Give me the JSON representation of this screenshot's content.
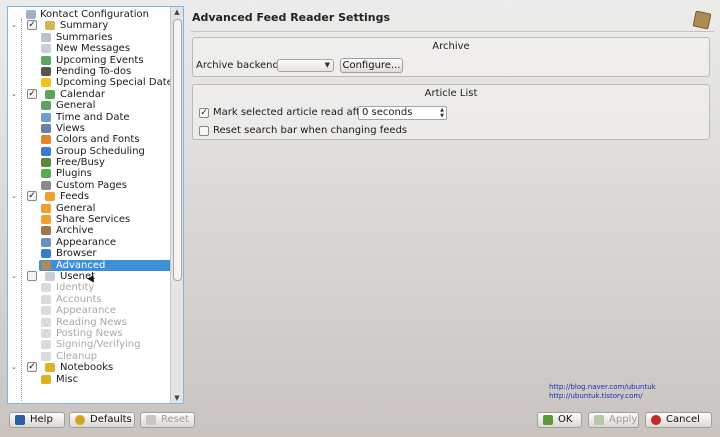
{
  "header": {
    "title": "Advanced Feed Reader Settings",
    "icon": "package-icon"
  },
  "tree": {
    "items": [
      {
        "label": "Kontact Configuration",
        "level": 0,
        "icon": "kontact-icon",
        "color": "#9fb0c8"
      },
      {
        "label": "Summary",
        "level": 1,
        "checked": true,
        "expanded": true,
        "icon": "summary-icon",
        "color": "#d9b35a"
      },
      {
        "label": "Summaries",
        "level": 2,
        "icon": "summaries-icon",
        "color": "#b7c2d3"
      },
      {
        "label": "New Messages",
        "level": 2,
        "icon": "mail-icon",
        "color": "#c9ced6"
      },
      {
        "label": "Upcoming Events",
        "level": 2,
        "icon": "calendar-icon",
        "color": "#5aa65a"
      },
      {
        "label": "Pending To-dos",
        "level": 2,
        "icon": "todo-icon",
        "color": "#555555"
      },
      {
        "label": "Upcoming Special Dates",
        "level": 2,
        "icon": "star-icon",
        "color": "#f0c419"
      },
      {
        "label": "Calendar",
        "level": 1,
        "checked": true,
        "expanded": true,
        "icon": "calendar-icon",
        "color": "#5aa65a"
      },
      {
        "label": "General",
        "level": 2,
        "icon": "calendar-general-icon",
        "color": "#5aa65a"
      },
      {
        "label": "Time and Date",
        "level": 2,
        "icon": "clock-icon",
        "color": "#6b9ec9"
      },
      {
        "label": "Views",
        "level": 2,
        "icon": "views-icon",
        "color": "#6d7fa3"
      },
      {
        "label": "Colors and Fonts",
        "level": 2,
        "icon": "colors-icon",
        "color": "#e1862b"
      },
      {
        "label": "Group Scheduling",
        "level": 2,
        "icon": "globe-icon",
        "color": "#3a7ec9"
      },
      {
        "label": "Free/Busy",
        "level": 2,
        "icon": "freebusy-icon",
        "color": "#5c8a3b"
      },
      {
        "label": "Plugins",
        "level": 2,
        "icon": "plugin-icon",
        "color": "#52b04a"
      },
      {
        "label": "Custom Pages",
        "level": 2,
        "icon": "wrench-icon",
        "color": "#8a8a8a"
      },
      {
        "label": "Feeds",
        "level": 1,
        "checked": true,
        "expanded": true,
        "icon": "feeds-icon",
        "color": "#f0a030"
      },
      {
        "label": "General",
        "level": 2,
        "icon": "feeds-general-icon",
        "color": "#f0a030"
      },
      {
        "label": "Share Services",
        "level": 2,
        "icon": "share-icon",
        "color": "#f0a030"
      },
      {
        "label": "Archive",
        "level": 2,
        "icon": "archive-icon",
        "color": "#9a7a4a"
      },
      {
        "label": "Appearance",
        "level": 2,
        "icon": "appearance-icon",
        "color": "#6b8fc0"
      },
      {
        "label": "Browser",
        "level": 2,
        "icon": "browser-icon",
        "color": "#3a7ec9"
      },
      {
        "label": "Advanced",
        "level": 2,
        "icon": "advanced-icon",
        "color": "#b08a54",
        "selected": true
      },
      {
        "label": "Usenet",
        "level": 1,
        "checked": false,
        "expanded": true,
        "icon": "usenet-icon",
        "color": "#c9ced6"
      },
      {
        "label": "Identity",
        "level": 2,
        "icon": "identity-icon",
        "color": "#b0b0b0",
        "disabled": true
      },
      {
        "label": "Accounts",
        "level": 2,
        "icon": "accounts-icon",
        "color": "#b0b0b0",
        "disabled": true
      },
      {
        "label": "Appearance",
        "level": 2,
        "icon": "appearance-icon",
        "color": "#b0b0b0",
        "disabled": true
      },
      {
        "label": "Reading News",
        "level": 2,
        "icon": "reading-icon",
        "color": "#b0b0b0",
        "disabled": true
      },
      {
        "label": "Posting News",
        "level": 2,
        "icon": "posting-icon",
        "color": "#b0b0b0",
        "disabled": true
      },
      {
        "label": "Signing/Verifying",
        "level": 2,
        "icon": "signing-icon",
        "color": "#b0b0b0",
        "disabled": true
      },
      {
        "label": "Cleanup",
        "level": 2,
        "icon": "cleanup-icon",
        "color": "#b0b0b0",
        "disabled": true
      },
      {
        "label": "Notebooks",
        "level": 1,
        "checked": true,
        "expanded": true,
        "icon": "notebook-icon",
        "color": "#e0b020"
      },
      {
        "label": "Misc",
        "level": 2,
        "icon": "misc-icon",
        "color": "#e0b020"
      }
    ]
  },
  "archive": {
    "title": "Archive",
    "backend_label": "Archive backend:",
    "backend_value": "",
    "configure_label": "Configure..."
  },
  "article": {
    "title": "Article List",
    "mark_read_label": "Mark selected article read after",
    "mark_read_checked": true,
    "mark_read_value": "0 seconds",
    "reset_search_label": "Reset search bar when changing feeds",
    "reset_search_checked": false
  },
  "urls": [
    "http://blog.naver.com/ubuntuk",
    "http://ubuntuk.tistory.com/"
  ],
  "buttons": {
    "help": "Help",
    "defaults": "Defaults",
    "reset": "Reset",
    "ok": "OK",
    "apply": "Apply",
    "cancel": "Cancel"
  }
}
